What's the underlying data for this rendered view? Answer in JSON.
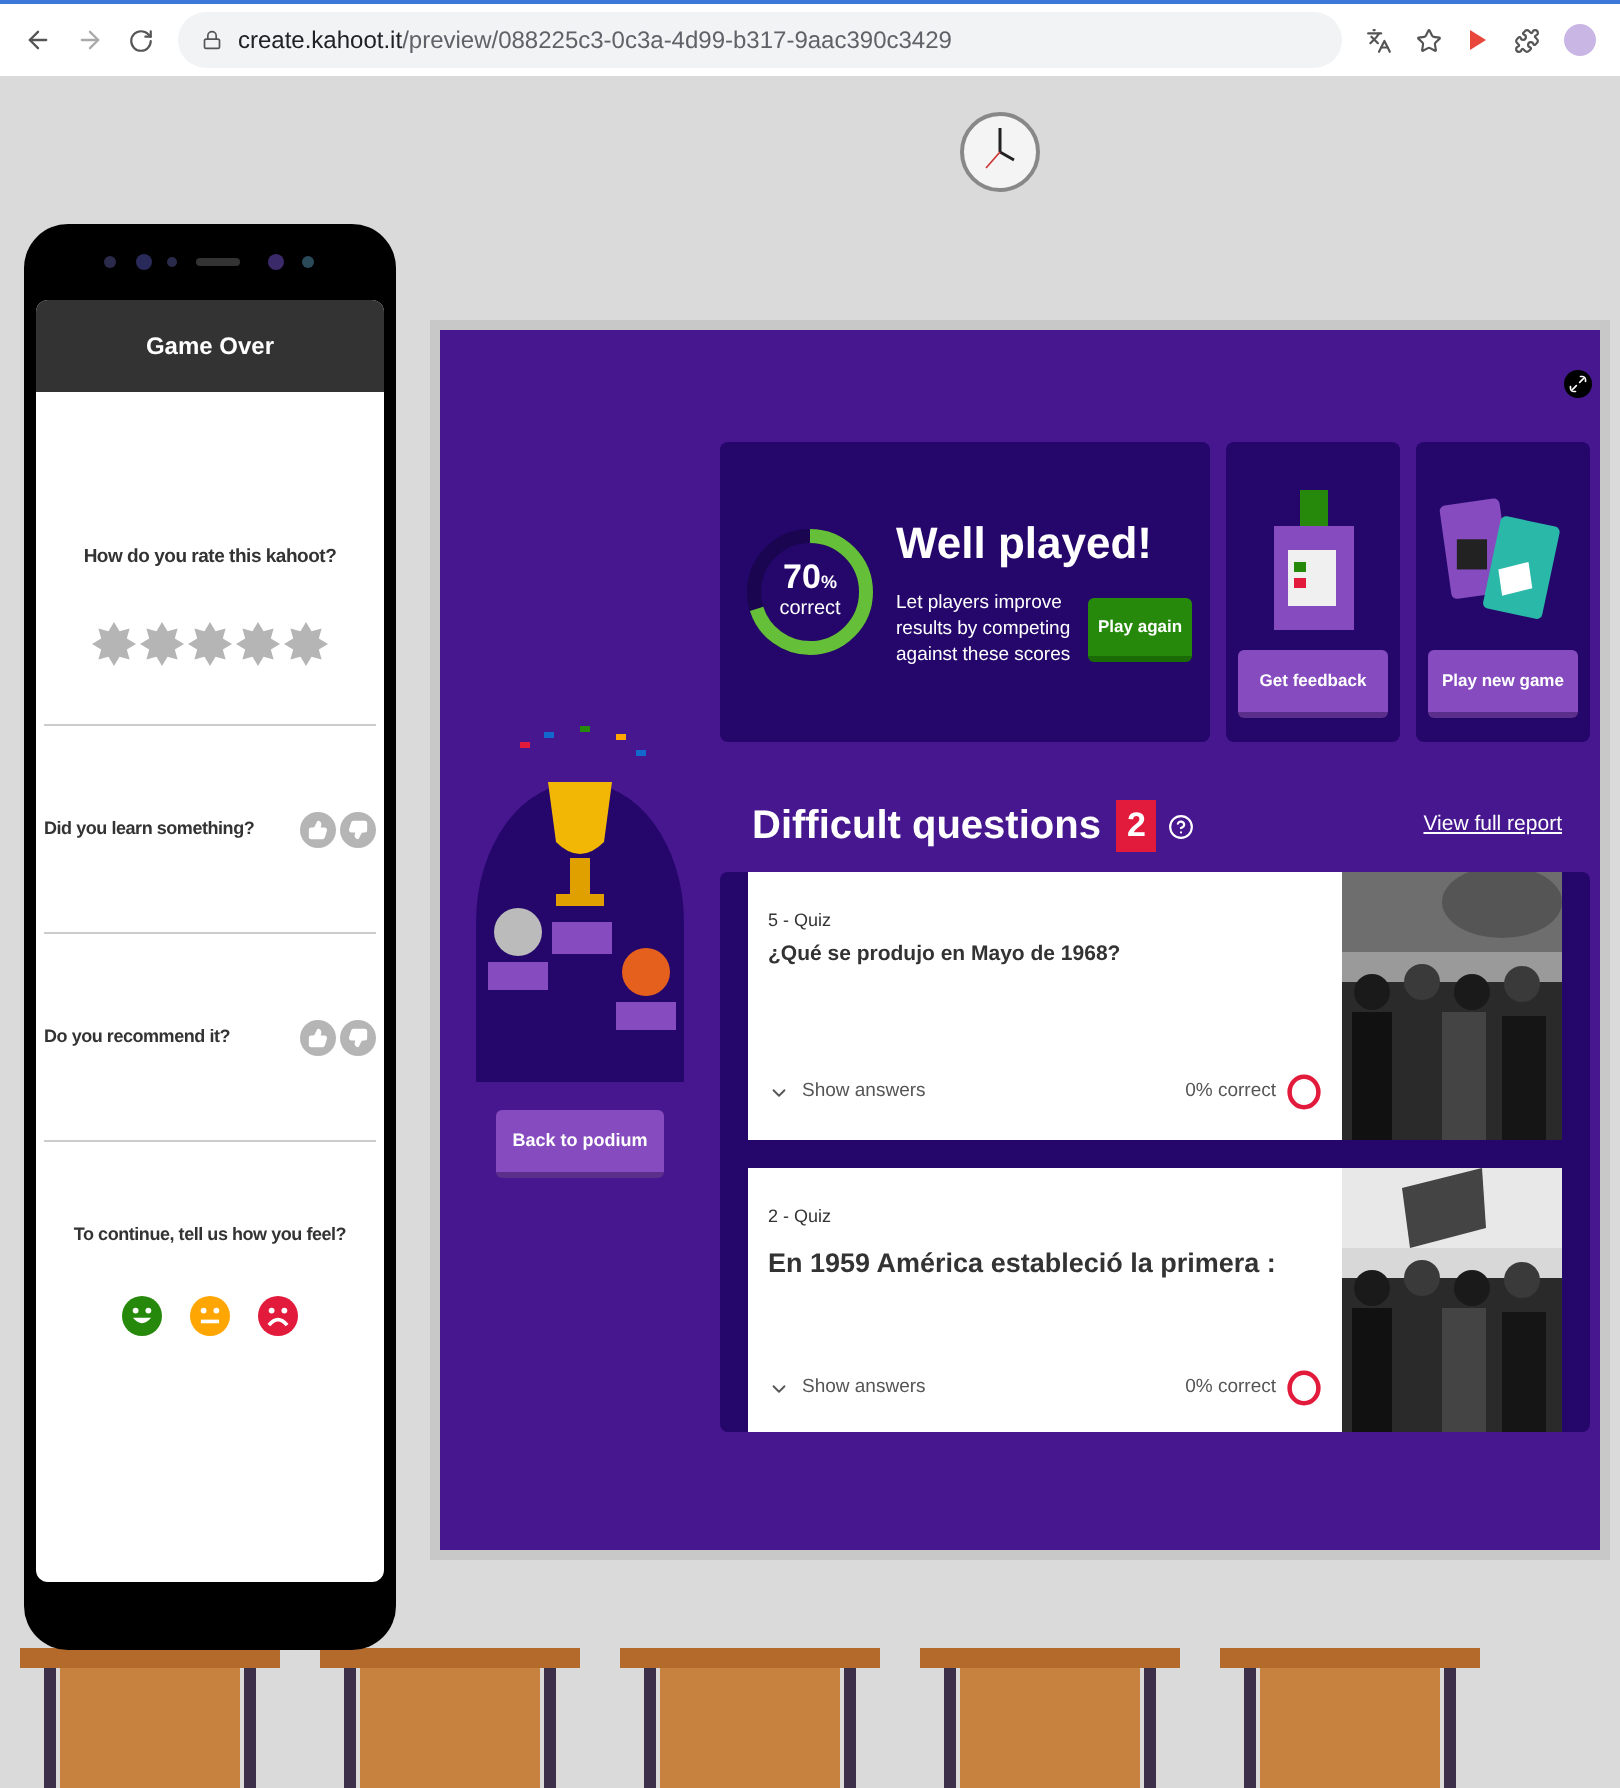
{
  "browser": {
    "url_host": "create.kahoot.it",
    "url_path": "/preview/088225c3-0c3a-4d99-b317-9aac390c3429"
  },
  "phone": {
    "title": "Game Over",
    "rating": {
      "question": "How do you rate this kahoot?",
      "stars": 0
    },
    "questions": [
      {
        "label": "Did you learn something?"
      },
      {
        "label": "Do you recommend it?"
      }
    ],
    "feelings": {
      "prompt": "To continue, tell us how you feel?",
      "faces": [
        {
          "kind": "happy",
          "color": "#26890c"
        },
        {
          "kind": "neutral",
          "color": "#ffa602"
        },
        {
          "kind": "sad",
          "color": "#e21b3c"
        }
      ]
    }
  },
  "summary": {
    "percent": "70",
    "percent_sign": "%",
    "correct_label": "correct",
    "level": 0.7,
    "title": "Well played!",
    "text": "Let players improve results by competing against these scores",
    "play_again": "Play again"
  },
  "actions": [
    {
      "kind": "feedback",
      "label": "Get feedback"
    },
    {
      "kind": "new_game",
      "label": "Play new game"
    }
  ],
  "podium": {
    "button": "Back to podium"
  },
  "difficult": {
    "title": "Difficult questions",
    "count": "2",
    "report_link": "View full report",
    "items": [
      {
        "number_type": "5 - Quiz",
        "question": "¿Qué se produjo en Mayo de 1968?",
        "large": false,
        "toggle": "Show answers",
        "score": "0% correct"
      },
      {
        "number_type": "2 - Quiz",
        "question": "En 1959 América estableció la primera :",
        "large": true,
        "toggle": "Show answers",
        "score": "0% correct"
      }
    ]
  }
}
